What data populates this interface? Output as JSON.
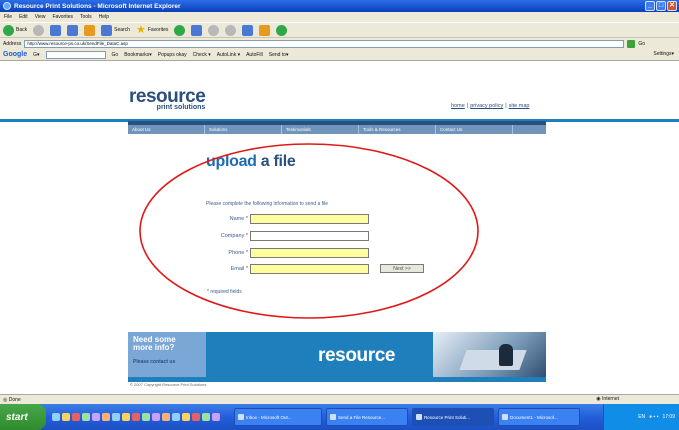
{
  "window": {
    "title": "Resource Print Solutions - Microsoft Internet Explorer",
    "controls": [
      "_",
      "□",
      "✕"
    ]
  },
  "menu": [
    "File",
    "Edit",
    "View",
    "Favorites",
    "Tools",
    "Help"
  ],
  "toolbar": {
    "back": "Back",
    "search": "Search",
    "favorites": "Favorites"
  },
  "address": {
    "label": "Address",
    "url": "http://www.resource-ps.co.uk/SendFile_DataC.asp",
    "go": "Go"
  },
  "googlebar": {
    "logo": "Google",
    "g_menu": "G▾",
    "go": "Go",
    "bookmarks": "Bookmarks▾",
    "popups": "Popups okay",
    "check": "Check ▾",
    "autolink": "AutoLink ▾",
    "autofill": "AutoFill",
    "send_to": "Send to▾",
    "settings": "Settings▾"
  },
  "site": {
    "logo_main": "resource",
    "logo_sub": "print solutions",
    "top_links": [
      "home",
      "privacy policy",
      "site map"
    ],
    "nav": [
      "About Us",
      "Solutions",
      "Testimonials",
      "Tools & Resources",
      "Contact Us"
    ],
    "heading_part1": "upload",
    "heading_part2": " a file",
    "instructions": "Please complete the following information to send a file",
    "form": {
      "fields": [
        {
          "label": "Name",
          "value": "",
          "highlight": true
        },
        {
          "label": "Company",
          "value": "",
          "highlight": false
        },
        {
          "label": "Phone",
          "value": "",
          "highlight": true
        },
        {
          "label": "Email",
          "value": "",
          "highlight": true
        }
      ],
      "required_mark": "*",
      "next_label": "Next >>",
      "required_note": "* required fields"
    },
    "promo": {
      "question_line1": "Need some",
      "question_line2": "more info?",
      "cta": "Please contact us",
      "brand": "resource"
    },
    "copyright": "© 2007 Copyright Resource Print Solutions"
  },
  "status": {
    "left": "Done",
    "zone": "Internet"
  },
  "taskbar": {
    "start": "start",
    "tasks": [
      "Inbox - Microsoft Out...",
      "Send a File Resource...",
      "Resource Print Soluti...",
      "Document1 - Microsof..."
    ],
    "tray_lang": "EN",
    "clock": "17:09"
  },
  "colors": {
    "brand_navy": "#2b4f7e",
    "brand_blue": "#1f7fbd",
    "annotation_red": "#e01818",
    "field_highlight": "#ffff9f"
  }
}
